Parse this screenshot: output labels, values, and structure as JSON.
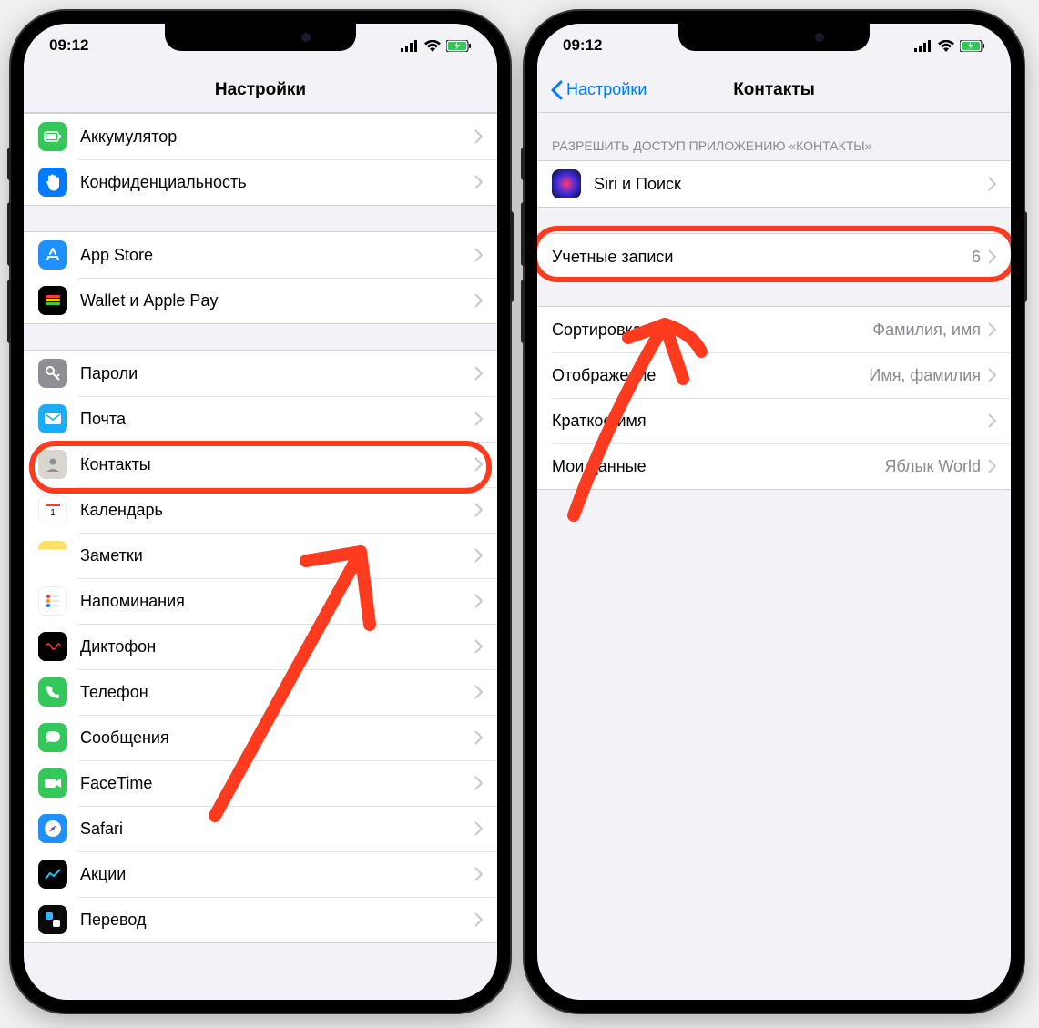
{
  "status": {
    "time": "09:12"
  },
  "left": {
    "title": "Настройки",
    "groups": [
      {
        "rows": [
          {
            "icon": "battery",
            "label": "Аккумулятор"
          },
          {
            "icon": "privacy",
            "label": "Конфиденциальность"
          }
        ]
      },
      {
        "rows": [
          {
            "icon": "appstore",
            "label": "App Store"
          },
          {
            "icon": "wallet",
            "label": "Wallet и Apple Pay"
          }
        ]
      },
      {
        "rows": [
          {
            "icon": "passwords",
            "label": "Пароли"
          },
          {
            "icon": "mail",
            "label": "Почта"
          },
          {
            "icon": "contacts",
            "label": "Контакты"
          },
          {
            "icon": "calendar",
            "label": "Календарь"
          },
          {
            "icon": "notes",
            "label": "Заметки"
          },
          {
            "icon": "reminders",
            "label": "Напоминания"
          },
          {
            "icon": "voice",
            "label": "Диктофон"
          },
          {
            "icon": "phone",
            "label": "Телефон"
          },
          {
            "icon": "messages",
            "label": "Сообщения"
          },
          {
            "icon": "facetime",
            "label": "FaceTime"
          },
          {
            "icon": "safari",
            "label": "Safari"
          },
          {
            "icon": "stocks",
            "label": "Акции"
          },
          {
            "icon": "translate",
            "label": "Перевод"
          }
        ]
      }
    ]
  },
  "right": {
    "back": "Настройки",
    "title": "Контакты",
    "section_header": "РАЗРЕШИТЬ ДОСТУП ПРИЛОЖЕНИЮ «КОНТАКТЫ»",
    "siri": {
      "label": "Siri и Поиск"
    },
    "accounts": {
      "label": "Учетные записи",
      "value": "6"
    },
    "rows": [
      {
        "label": "Сортировка",
        "value": "Фамилия, имя"
      },
      {
        "label": "Отображение",
        "value": "Имя, фамилия"
      },
      {
        "label": "Краткое имя",
        "value": ""
      },
      {
        "label": "Мои данные",
        "value": "Яблык World"
      }
    ]
  }
}
